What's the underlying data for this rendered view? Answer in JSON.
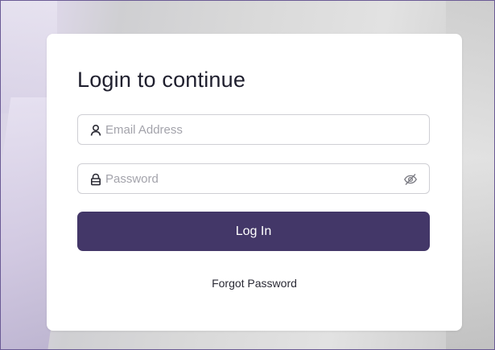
{
  "login": {
    "title": "Login to continue",
    "email": {
      "placeholder": "Email Address",
      "value": "",
      "icon": "user-icon"
    },
    "password": {
      "placeholder": "Password",
      "value": "",
      "icon": "lock-icon",
      "toggle_icon": "eye-off-icon"
    },
    "submit_label": "Log In",
    "forgot_label": "Forgot Password"
  },
  "colors": {
    "primary": "#433768",
    "card": "#ffffff",
    "border": "#6b5b95"
  }
}
